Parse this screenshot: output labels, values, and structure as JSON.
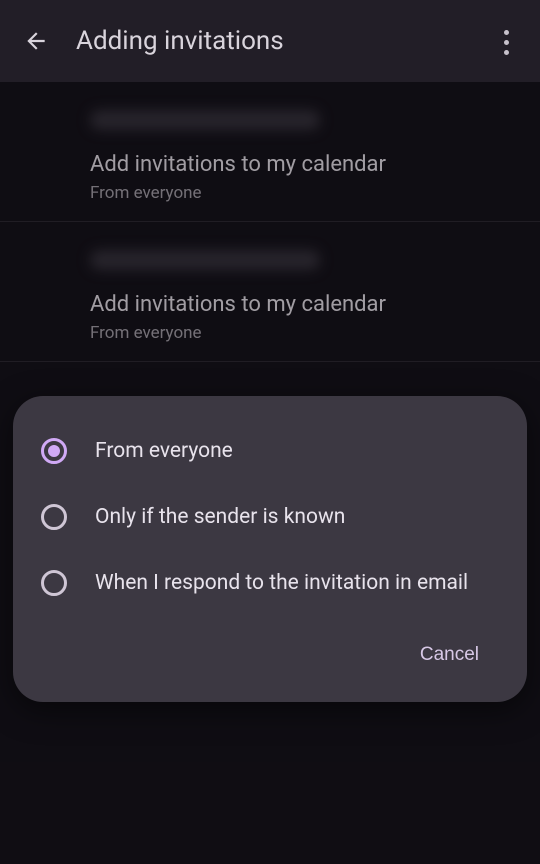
{
  "header": {
    "title": "Adding invitations"
  },
  "sections": [
    {
      "title": "Add invitations to my calendar",
      "subtitle": "From everyone"
    },
    {
      "title": "Add invitations to my calendar",
      "subtitle": "From everyone"
    }
  ],
  "dialog": {
    "options": [
      {
        "label": "From everyone",
        "selected": true
      },
      {
        "label": "Only if the sender is known",
        "selected": false
      },
      {
        "label": "When I respond to the invitation in email",
        "selected": false
      }
    ],
    "cancel": "Cancel"
  },
  "colors": {
    "accent": "#d0a9f5",
    "surface": "#3c3842",
    "background": "#15121a"
  }
}
